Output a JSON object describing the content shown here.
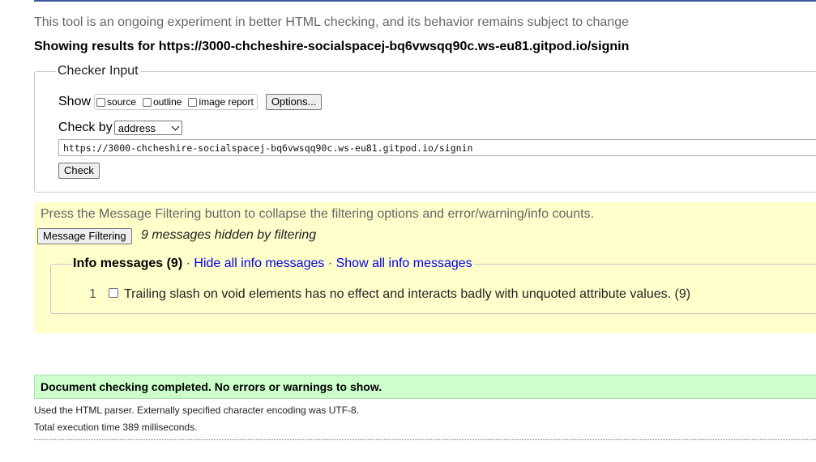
{
  "header": {
    "experiment_note": "This tool is an ongoing experiment in better HTML checking, and its behavior remains subject to change",
    "results_for": "Showing results for https://3000-chcheshire-socialspacej-bq6vwsqq90c.ws-eu81.gitpod.io/signin"
  },
  "checker_input": {
    "legend": "Checker Input",
    "show_label": "Show",
    "show_options": [
      {
        "label": "source",
        "checked": false
      },
      {
        "label": "outline",
        "checked": false
      },
      {
        "label": "image report",
        "checked": false
      }
    ],
    "options_button": "Options...",
    "check_by_label": "Check by",
    "check_by_value": "address",
    "url_value": "https://3000-chcheshire-socialspacej-bq6vwsqq90c.ws-eu81.gitpod.io/signin",
    "check_button": "Check"
  },
  "filtering": {
    "note": "Press the Message Filtering button to collapse the filtering options and error/warning/info counts.",
    "button": "Message Filtering",
    "hidden_count": "9 messages hidden by filtering",
    "info_group": {
      "title": "Info messages (9)",
      "separator": "·",
      "hide_link": "Hide all info messages",
      "show_link": "Show all info messages",
      "messages": [
        {
          "number": "1",
          "text": "Trailing slash on void elements has no effect and interacts badly with unquoted attribute values. (9)",
          "checked": false
        }
      ]
    }
  },
  "status": {
    "success": "Document checking completed. No errors or warnings to show.",
    "parser_note": "Used the HTML parser. Externally specified character encoding was UTF-8.",
    "execution_time": "Total execution time 389 milliseconds."
  },
  "colors": {
    "filter_bg": "#ffffcc",
    "success_bg": "#ccffcc",
    "link": "#0000ee",
    "muted_text": "#666666"
  }
}
